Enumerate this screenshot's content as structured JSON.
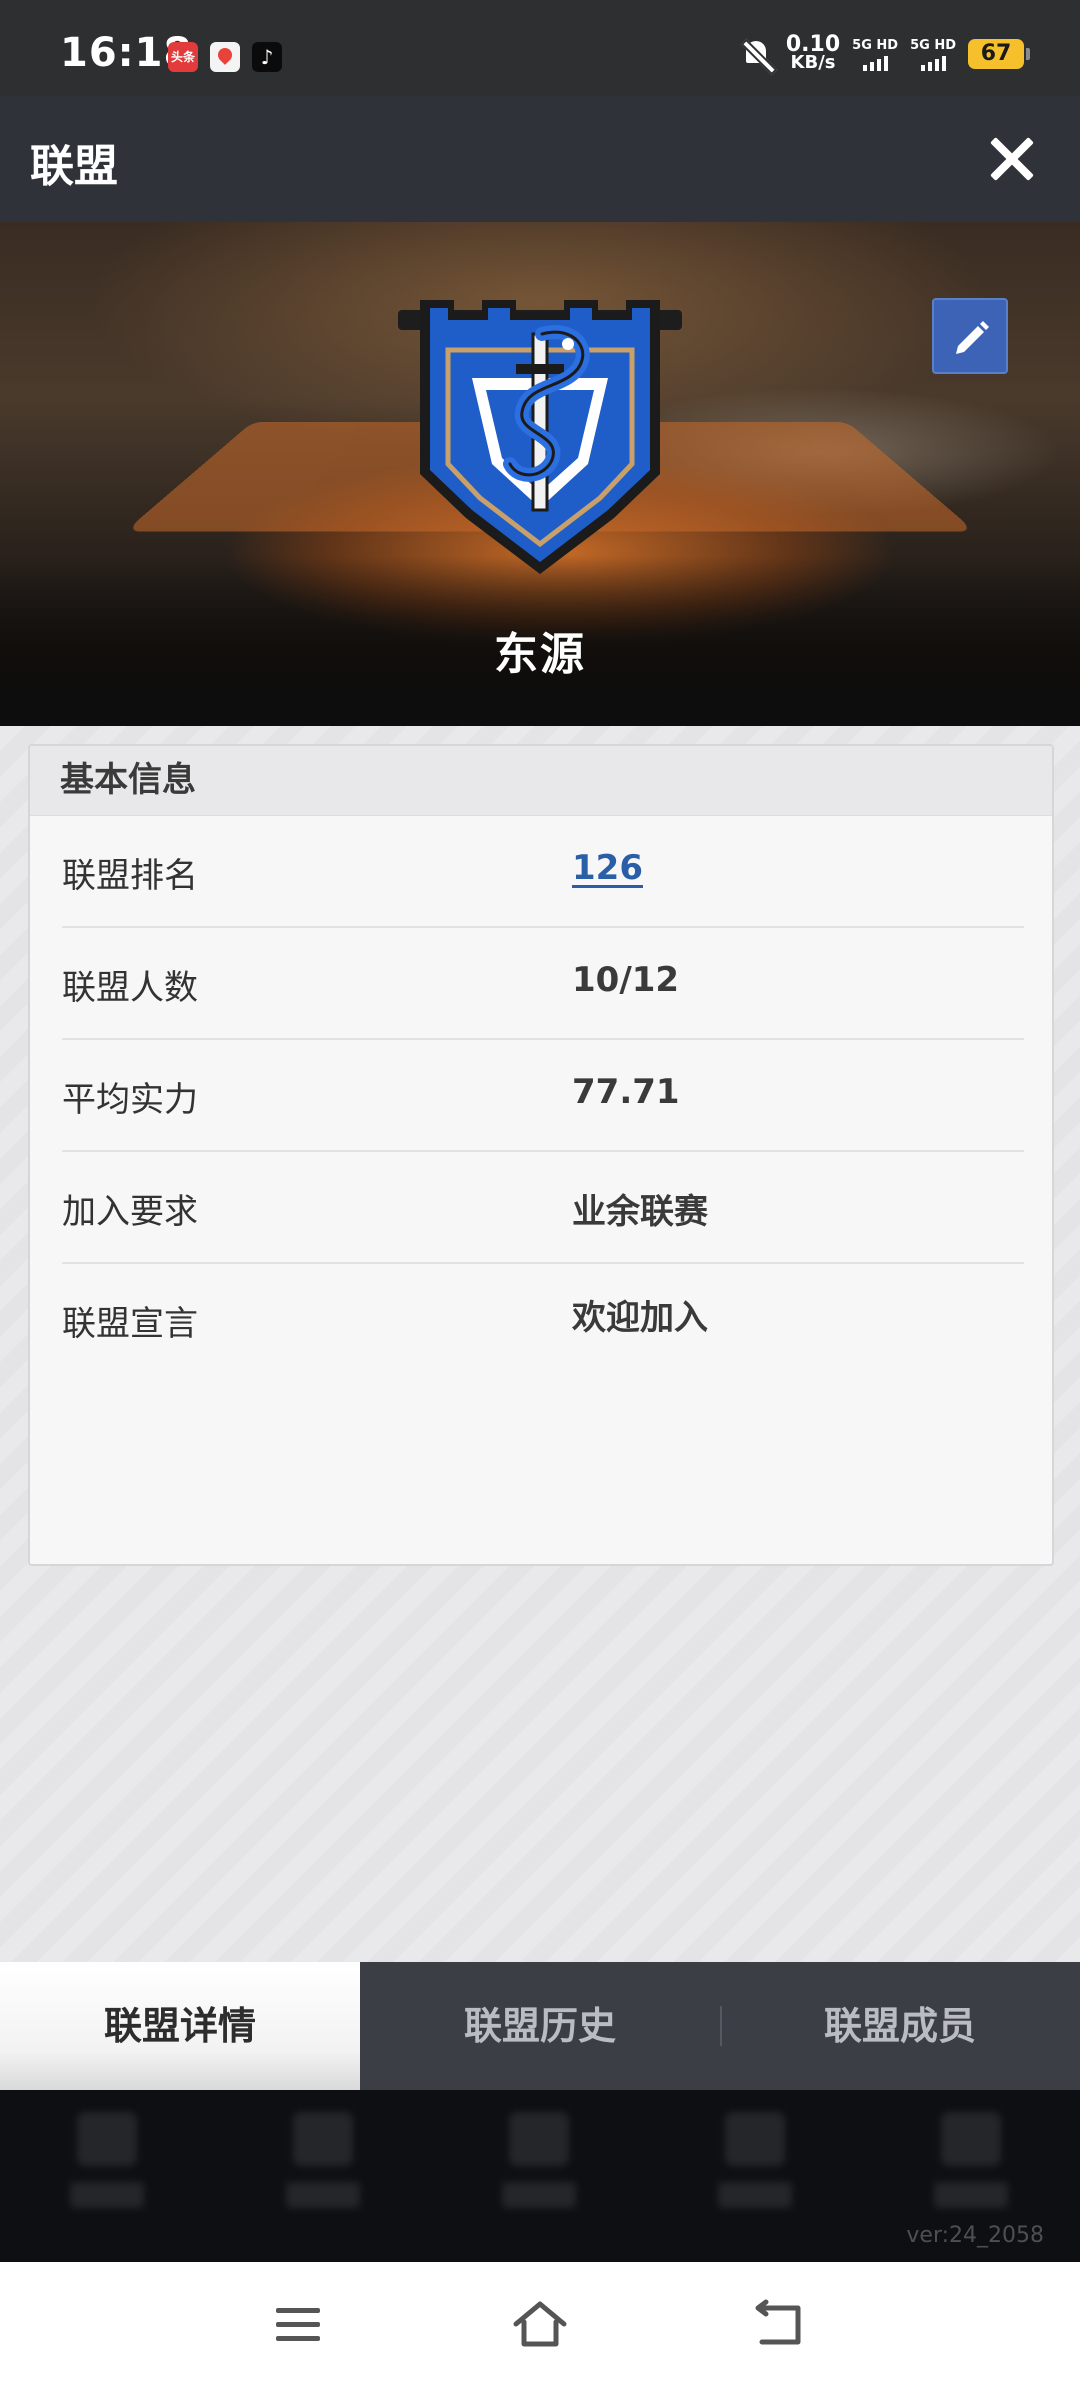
{
  "status_bar": {
    "time": "16:18",
    "apps": [
      "头条",
      "map-pin-icon",
      "tiktok-icon"
    ],
    "net_speed_value": "0.10",
    "net_speed_unit": "KB/s",
    "sim1": "5G HD",
    "sim2": "5G HD",
    "battery": "67"
  },
  "header": {
    "title": "联盟",
    "close_icon": "close-icon"
  },
  "banner": {
    "league_name": "东源",
    "edit_icon": "pencil-icon"
  },
  "info_card": {
    "heading": "基本信息",
    "rows": [
      {
        "label": "联盟排名",
        "value": "126"
      },
      {
        "label": "联盟人数",
        "value": "10/12"
      },
      {
        "label": "平均实力",
        "value": "77.71"
      },
      {
        "label": "加入要求",
        "value": "业余联赛"
      },
      {
        "label": "联盟宣言",
        "value": "欢迎加入"
      }
    ]
  },
  "tabs": [
    {
      "label": "联盟详情",
      "active": true
    },
    {
      "label": "联盟历史",
      "active": false
    },
    {
      "label": "联盟成员",
      "active": false
    }
  ],
  "footer": {
    "version": "ver:24_2058"
  },
  "colors": {
    "link": "#2a5fa8",
    "edit_button": "#3c63b6",
    "titlebar": "#2f3239",
    "tab_bar": "#3b3e45"
  }
}
